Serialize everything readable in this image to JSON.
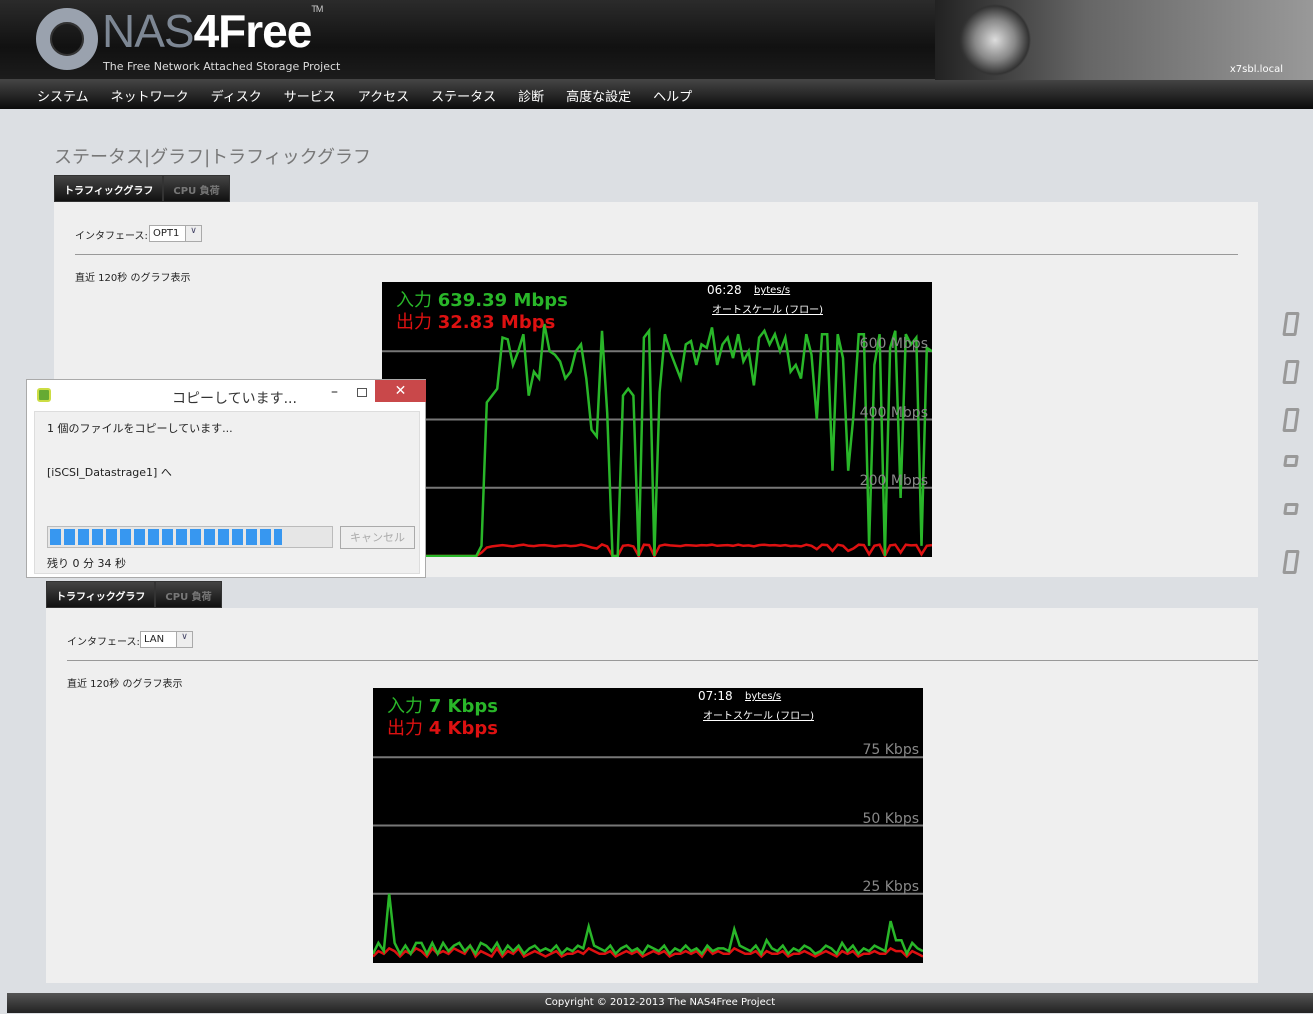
{
  "header": {
    "logo_main": "NAS",
    "logo_bold": "4Free",
    "logo_tm": "TM",
    "tagline": "The Free Network Attached Storage Project",
    "hostname": "x7sbl.local"
  },
  "nav": [
    "システム",
    "ネットワーク",
    "ディスク",
    "サービス",
    "アクセス",
    "ステータス",
    "診断",
    "高度な設定",
    "ヘルプ"
  ],
  "page_title": "ステータス|グラフ|トラフィックグラフ",
  "tabs": {
    "traffic": "トラフィックグラフ",
    "cpu": "CPU 負荷"
  },
  "panel1": {
    "iface_label": "インタフェース:",
    "iface_value": "OPT1",
    "caption": "直近 120秒 のグラフ表示"
  },
  "panel2": {
    "iface_label": "インタフェース:",
    "iface_value": "LAN",
    "caption": "直近 120秒 のグラフ表示"
  },
  "colors": {
    "in": "#29b629",
    "out": "#dd1111",
    "progress": "#3797f0"
  },
  "chart_data": [
    {
      "type": "line",
      "time": "06:28",
      "unit_label": "bytes/s",
      "autoscale": "オートスケール (フロー)",
      "legend": {
        "in_label": "入力",
        "in_value": "639.39 Mbps",
        "out_label": "出力",
        "out_value": "32.83 Mbps"
      },
      "yticks": [
        "600 Mbps",
        "400 Mbps",
        "200 Mbps"
      ],
      "ytick_values": [
        600,
        400,
        200
      ],
      "ylim": [
        0,
        800
      ],
      "xlim_seconds": 120,
      "series": [
        {
          "name": "入力",
          "values": [
            0,
            0,
            0,
            0,
            0,
            0,
            0,
            0,
            0,
            0,
            0,
            0,
            0,
            0,
            0,
            0,
            0,
            0,
            0,
            30,
            450,
            470,
            490,
            640,
            635,
            560,
            600,
            650,
            470,
            540,
            520,
            680,
            600,
            590,
            570,
            520,
            540,
            600,
            620,
            520,
            370,
            350,
            660,
            420,
            0,
            0,
            470,
            490,
            470,
            0,
            640,
            660,
            0,
            480,
            650,
            600,
            560,
            520,
            620,
            630,
            560,
            620,
            610,
            670,
            560,
            620,
            640,
            580,
            650,
            570,
            600,
            500,
            640,
            660,
            620,
            650,
            600,
            640,
            540,
            560,
            520,
            650,
            590,
            400,
            650,
            650,
            250,
            650,
            580,
            250,
            410,
            650,
            650,
            30,
            560,
            650,
            0,
            610,
            660,
            170,
            650,
            620,
            640,
            30,
            610,
            600
          ]
        },
        {
          "name": "出力",
          "values": [
            0,
            0,
            0,
            0,
            0,
            0,
            0,
            0,
            0,
            0,
            0,
            0,
            0,
            0,
            0,
            0,
            0,
            0,
            0,
            10,
            25,
            28,
            30,
            32,
            30,
            28,
            31,
            33,
            30,
            29,
            31,
            32,
            30,
            28,
            30,
            31,
            29,
            30,
            33,
            30,
            25,
            22,
            34,
            28,
            0,
            0,
            30,
            32,
            28,
            0,
            33,
            32,
            0,
            30,
            33,
            31,
            30,
            29,
            32,
            31,
            30,
            32,
            31,
            33,
            30,
            31,
            32,
            30,
            33,
            30,
            31,
            28,
            32,
            33,
            31,
            32,
            30,
            32,
            29,
            30,
            28,
            33,
            30,
            20,
            33,
            32,
            15,
            33,
            30,
            15,
            22,
            33,
            32,
            5,
            30,
            33,
            0,
            31,
            33,
            10,
            33,
            31,
            32,
            5,
            30,
            32
          ]
        }
      ]
    },
    {
      "type": "line",
      "time": "07:18",
      "unit_label": "bytes/s",
      "autoscale": "オートスケール (フロー)",
      "legend": {
        "in_label": "入力",
        "in_value": "7 Kbps",
        "out_label": "出力",
        "out_value": "4 Kbps"
      },
      "yticks": [
        "75 Kbps",
        "50 Kbps",
        "25 Kbps"
      ],
      "ytick_values": [
        75,
        50,
        25
      ],
      "ylim": [
        0,
        100
      ],
      "xlim_seconds": 120,
      "series": [
        {
          "name": "入力",
          "values": [
            3,
            7,
            4,
            25,
            7,
            3,
            6,
            3,
            7,
            7,
            3,
            7,
            3,
            7,
            4,
            6,
            7,
            4,
            6,
            3,
            7,
            6,
            4,
            7,
            3,
            6,
            4,
            6,
            3,
            5,
            6,
            4,
            5,
            4,
            6,
            3,
            5,
            4,
            6,
            5,
            13,
            6,
            5,
            4,
            6,
            3,
            5,
            6,
            4,
            5,
            3,
            6,
            5,
            4,
            6,
            3,
            5,
            4,
            6,
            4,
            5,
            3,
            6,
            4,
            5,
            5,
            4,
            12,
            6,
            5,
            4,
            6,
            3,
            8,
            5,
            4,
            6,
            3,
            5,
            4,
            6,
            5,
            3,
            4,
            6,
            5,
            3,
            7,
            4,
            6,
            3,
            5,
            4,
            6,
            5,
            4,
            15,
            8,
            8,
            3,
            7,
            5,
            4
          ]
        },
        {
          "name": "出力",
          "values": [
            2,
            4,
            3,
            5,
            4,
            2,
            4,
            3,
            5,
            4,
            2,
            5,
            3,
            4,
            3,
            5,
            4,
            3,
            6,
            2,
            4,
            3,
            2,
            5,
            2,
            4,
            3,
            5,
            2,
            3,
            4,
            3,
            2,
            3,
            4,
            2,
            3,
            3,
            4,
            3,
            5,
            4,
            3,
            3,
            4,
            2,
            3,
            4,
            3,
            4,
            2,
            3,
            4,
            3,
            4,
            2,
            3,
            3,
            4,
            3,
            4,
            2,
            5,
            3,
            4,
            3,
            3,
            5,
            4,
            3,
            3,
            4,
            2,
            4,
            3,
            3,
            4,
            2,
            3,
            3,
            4,
            3,
            2,
            3,
            4,
            3,
            2,
            4,
            3,
            4,
            2,
            3,
            3,
            4,
            3,
            3,
            5,
            4,
            4,
            2,
            4,
            3,
            2
          ]
        }
      ]
    }
  ],
  "dialog": {
    "title": "コピーしています...",
    "message": "1 個のファイルをコピーしています...",
    "destination": "[iSCSI_Datastrage1] へ",
    "progress": 0.83,
    "cancel": "キャンセル",
    "remaining": "残り 0 分 34 秒",
    "close": "✕",
    "minimize": "–"
  },
  "footer": "Copyright © 2012-2013 The NAS4Free Project"
}
